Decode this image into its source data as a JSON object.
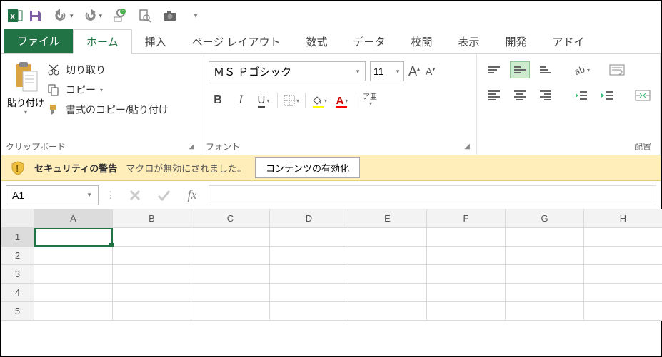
{
  "qat": {
    "items": [
      "excel",
      "save",
      "undo",
      "redo",
      "touch",
      "preview",
      "camera",
      "more"
    ]
  },
  "tabs": {
    "file": "ファイル",
    "items": [
      "ホーム",
      "挿入",
      "ページ レイアウト",
      "数式",
      "データ",
      "校閲",
      "表示",
      "開発",
      "アドイ"
    ],
    "active_index": 0
  },
  "clipboard": {
    "paste_label": "貼り付け",
    "cut_label": "切り取り",
    "copy_label": "コピー",
    "format_painter_label": "書式のコピー/貼り付け",
    "group_label": "クリップボード"
  },
  "font": {
    "name": "ＭＳ Ｐゴシック",
    "size": "11",
    "group_label": "フォント",
    "bold": "B",
    "italic": "I",
    "underline": "U",
    "ruby": "ア亜"
  },
  "alignment": {
    "group_label": "配置"
  },
  "security": {
    "title": "セキュリティの警告",
    "message": "マクロが無効にされました。",
    "button": "コンテンツの有効化"
  },
  "formula": {
    "namebox": "A1",
    "fx_label": "fx",
    "value": ""
  },
  "grid": {
    "columns": [
      "A",
      "B",
      "C",
      "D",
      "E",
      "F",
      "G",
      "H"
    ],
    "rows": [
      "1",
      "2",
      "3",
      "4",
      "5"
    ],
    "selected": {
      "col": 0,
      "row": 0
    }
  },
  "icons": {
    "dropdown": "▾",
    "dropdown_small": "▼",
    "grow": "A",
    "shrink": "A"
  }
}
